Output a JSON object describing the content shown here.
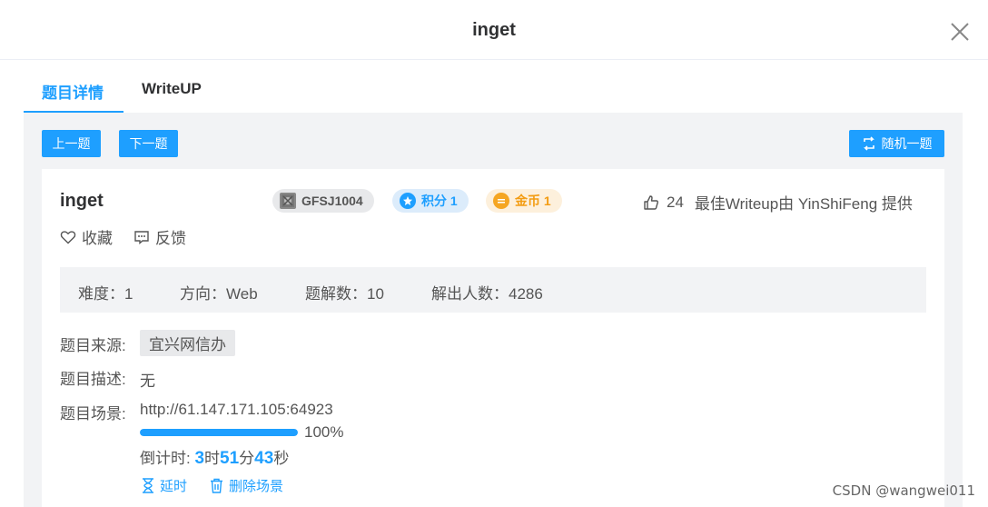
{
  "modal": {
    "title": "inget"
  },
  "tabs": [
    {
      "label": "题目详情",
      "active": true
    },
    {
      "label": "WriteUP",
      "active": false
    }
  ],
  "nav": {
    "prev_label": "上一题",
    "next_label": "下一题",
    "random_label": "随机一题"
  },
  "challenge": {
    "name": "inget",
    "id_badge": "GFSJ1004",
    "score_badge": "积分 1",
    "coin_badge": "金币 1",
    "likes": "24",
    "best_writeup": "最佳Writeup由 YinShiFeng 提供",
    "favorite_label": "收藏",
    "feedback_label": "反馈"
  },
  "stats": {
    "difficulty": "难度：1",
    "direction": "方向：Web",
    "solves": "题解数：10",
    "solvers": "解出人数：4286"
  },
  "details": {
    "source_label": "题目来源:",
    "source_value": "宜兴网信办",
    "description_label": "题目描述:",
    "description_value": "无",
    "scene_label": "题目场景:",
    "scene_url": "http://61.147.171.105:64923",
    "progress_percent": 100,
    "progress_text": "100%",
    "countdown_prefix": "倒计时: ",
    "countdown_hours": "3",
    "countdown_hour_unit": "时",
    "countdown_minutes": "51",
    "countdown_minute_unit": "分",
    "countdown_seconds": "43",
    "countdown_second_unit": "秒",
    "extend_label": "延时",
    "delete_label": "删除场景"
  },
  "watermark": "CSDN @wangwei011",
  "colors": {
    "accent": "#1e9fff",
    "coin": "#f39c12",
    "panel_bg": "#f2f3f5"
  }
}
